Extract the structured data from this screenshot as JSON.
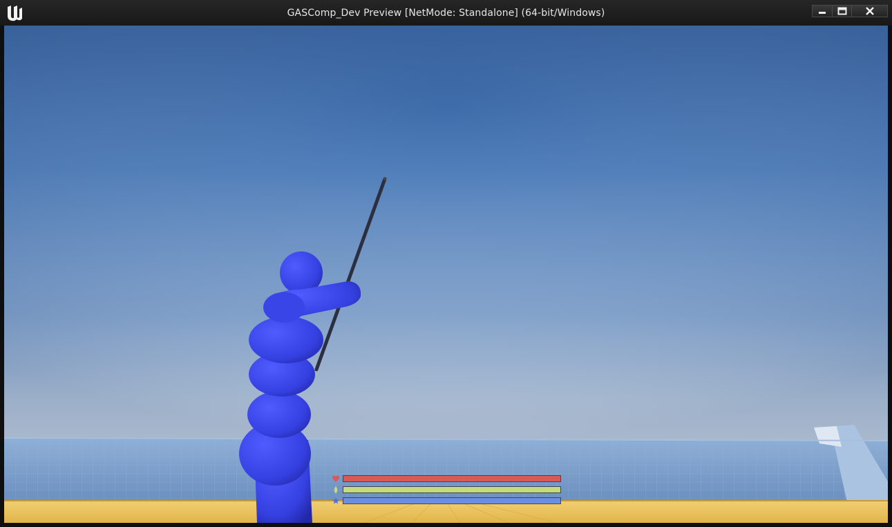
{
  "window": {
    "title": "GASComp_Dev Preview [NetMode: Standalone]  (64-bit/Windows)",
    "controls": [
      "minimize",
      "maximize",
      "close"
    ]
  },
  "hud": {
    "bars": [
      {
        "stat": "health",
        "icon": "heart-icon",
        "fill_fraction": 1.0,
        "color": "#d9585a"
      },
      {
        "stat": "stamina",
        "icon": "stamina-icon",
        "fill_fraction": 1.0,
        "color": "#c6dc7c"
      },
      {
        "stat": "mana",
        "icon": "mana-icon",
        "fill_fraction": 1.0,
        "color": "#6a8ee0"
      }
    ]
  },
  "colors": {
    "sky_top": "#2f5b99",
    "sky_bottom": "#c6d6e6",
    "character": "#3b44e6",
    "floor": "#e8bf55",
    "wall": "#7da0cc"
  }
}
